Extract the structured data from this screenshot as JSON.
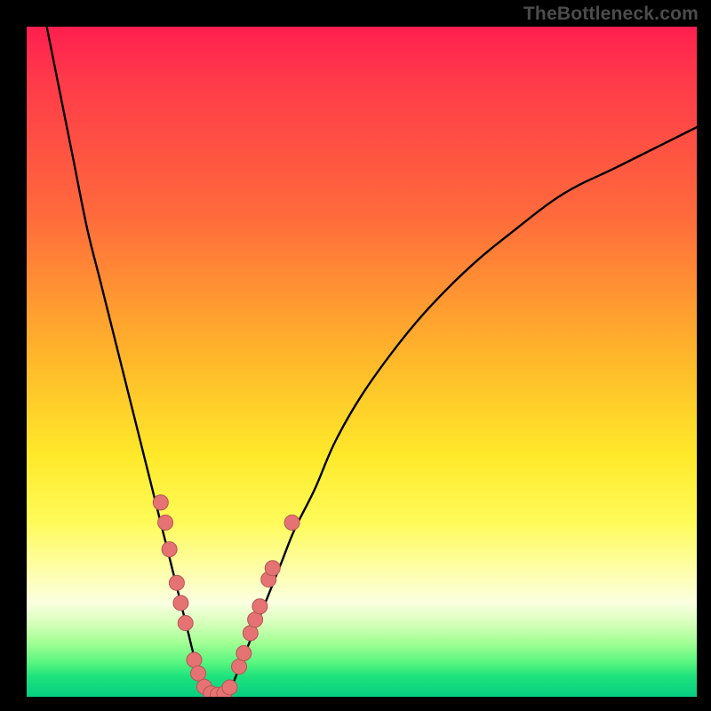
{
  "watermark": "TheBottleneck.com",
  "colors": {
    "background": "#000000",
    "curve_stroke": "#000000",
    "marker_fill": "#e57373",
    "marker_stroke": "#b55454",
    "watermark": "#4c4c4c"
  },
  "chart_data": {
    "type": "line",
    "title": "",
    "xlabel": "",
    "ylabel": "",
    "xlim": [
      0,
      100
    ],
    "ylim": [
      0,
      100
    ],
    "grid": false,
    "legend": false,
    "background_gradient": [
      {
        "stop": 0,
        "color": "#ff1f4f"
      },
      {
        "stop": 50,
        "color": "#ffb92a"
      },
      {
        "stop": 74,
        "color": "#fffb5a"
      },
      {
        "stop": 86,
        "color": "#faffe0"
      },
      {
        "stop": 100,
        "color": "#07cf82"
      }
    ],
    "series": [
      {
        "name": "left-curve",
        "x": [
          3,
          5,
          7,
          9,
          11,
          13,
          15,
          17,
          19,
          20,
          21,
          22,
          23,
          24,
          25,
          26,
          27
        ],
        "y_pct": [
          100,
          90,
          80,
          70,
          62,
          54,
          46,
          38,
          30,
          26,
          22,
          18,
          14,
          10,
          6,
          3,
          0
        ]
      },
      {
        "name": "right-curve",
        "x": [
          30,
          32,
          34,
          36,
          38,
          40,
          43,
          46,
          50,
          55,
          60,
          66,
          72,
          80,
          88,
          96,
          100
        ],
        "y_pct": [
          0,
          5,
          10,
          15,
          20,
          25,
          31,
          38,
          45,
          52,
          58,
          64,
          69,
          75,
          79,
          83,
          85
        ]
      }
    ],
    "markers": [
      {
        "x": 20.0,
        "y_pct": 29
      },
      {
        "x": 20.7,
        "y_pct": 26
      },
      {
        "x": 21.3,
        "y_pct": 22
      },
      {
        "x": 22.4,
        "y_pct": 17
      },
      {
        "x": 23.0,
        "y_pct": 14
      },
      {
        "x": 23.7,
        "y_pct": 11
      },
      {
        "x": 25.0,
        "y_pct": 5.5
      },
      {
        "x": 25.6,
        "y_pct": 3.5
      },
      {
        "x": 26.5,
        "y_pct": 1.5
      },
      {
        "x": 27.5,
        "y_pct": 0.5
      },
      {
        "x": 28.5,
        "y_pct": 0.3
      },
      {
        "x": 29.5,
        "y_pct": 0.5
      },
      {
        "x": 30.3,
        "y_pct": 1.4
      },
      {
        "x": 31.7,
        "y_pct": 4.5
      },
      {
        "x": 32.4,
        "y_pct": 6.5
      },
      {
        "x": 33.4,
        "y_pct": 9.5
      },
      {
        "x": 34.1,
        "y_pct": 11.5
      },
      {
        "x": 34.8,
        "y_pct": 13.5
      },
      {
        "x": 36.1,
        "y_pct": 17.5
      },
      {
        "x": 36.7,
        "y_pct": 19.2
      },
      {
        "x": 39.6,
        "y_pct": 26.0
      }
    ]
  }
}
